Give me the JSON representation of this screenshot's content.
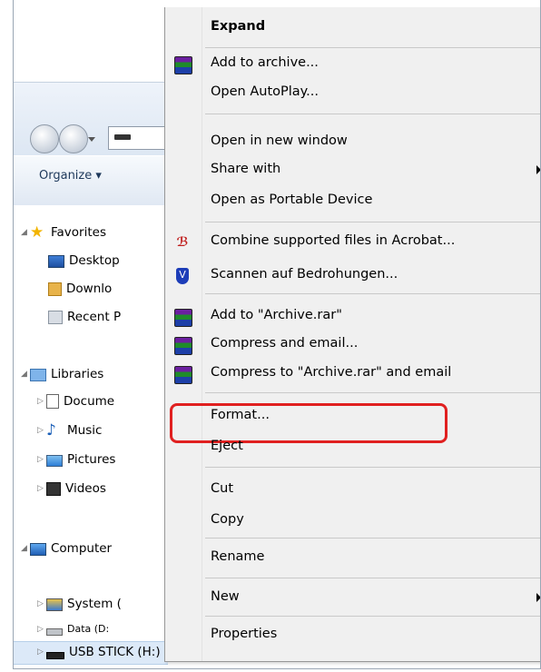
{
  "explorer": {
    "organize_label": "Organize ▾",
    "tree": [
      {
        "label": "Favorites",
        "icon": "favorites-star-icon",
        "level": 0
      },
      {
        "label": "Desktop",
        "icon": "desktop-icon",
        "level": 1
      },
      {
        "label": "Downlo",
        "icon": "downloads-icon",
        "level": 1
      },
      {
        "label": "Recent P",
        "icon": "recent-places-icon",
        "level": 1
      },
      {
        "label": "Libraries",
        "icon": "libraries-icon",
        "level": 0
      },
      {
        "label": "Docume",
        "icon": "documents-icon",
        "level": 1
      },
      {
        "label": "Music",
        "icon": "music-icon",
        "level": 1
      },
      {
        "label": "Pictures",
        "icon": "pictures-icon",
        "level": 1
      },
      {
        "label": "Videos",
        "icon": "videos-icon",
        "level": 1
      },
      {
        "label": "Computer",
        "icon": "computer-icon",
        "level": 0
      },
      {
        "label": "System (",
        "icon": "system-drive-icon",
        "level": 1
      },
      {
        "label": "Data (D:",
        "icon": "data-drive-icon",
        "level": 1
      },
      {
        "label": "USB STICK (H:)",
        "icon": "usb-drive-icon",
        "level": 1
      }
    ]
  },
  "context_menu": {
    "items": [
      {
        "label": "Expand",
        "bold": true
      },
      {
        "label": "Add to archive...",
        "icon": "winrar-icon"
      },
      {
        "label": "Open AutoPlay..."
      },
      {
        "label": "Open in new window"
      },
      {
        "label": "Share with",
        "submenu": true
      },
      {
        "label": "Open as Portable Device"
      },
      {
        "label": "Combine supported files in Acrobat...",
        "icon": "acrobat-icon"
      },
      {
        "label": "Scannen auf Bedrohungen...",
        "icon": "antivirus-shield-icon"
      },
      {
        "label": "Add to \"Archive.rar\"",
        "icon": "winrar-icon"
      },
      {
        "label": "Compress and email...",
        "icon": "winrar-icon"
      },
      {
        "label": "Compress to \"Archive.rar\" and email",
        "icon": "winrar-icon"
      },
      {
        "label": "Format..."
      },
      {
        "label": "Eject"
      },
      {
        "label": "Cut"
      },
      {
        "label": "Copy"
      },
      {
        "label": "Rename"
      },
      {
        "label": "New",
        "submenu": true
      },
      {
        "label": "Properties"
      }
    ],
    "highlighted_item": "Format...",
    "highlight_color": "#e02020"
  }
}
